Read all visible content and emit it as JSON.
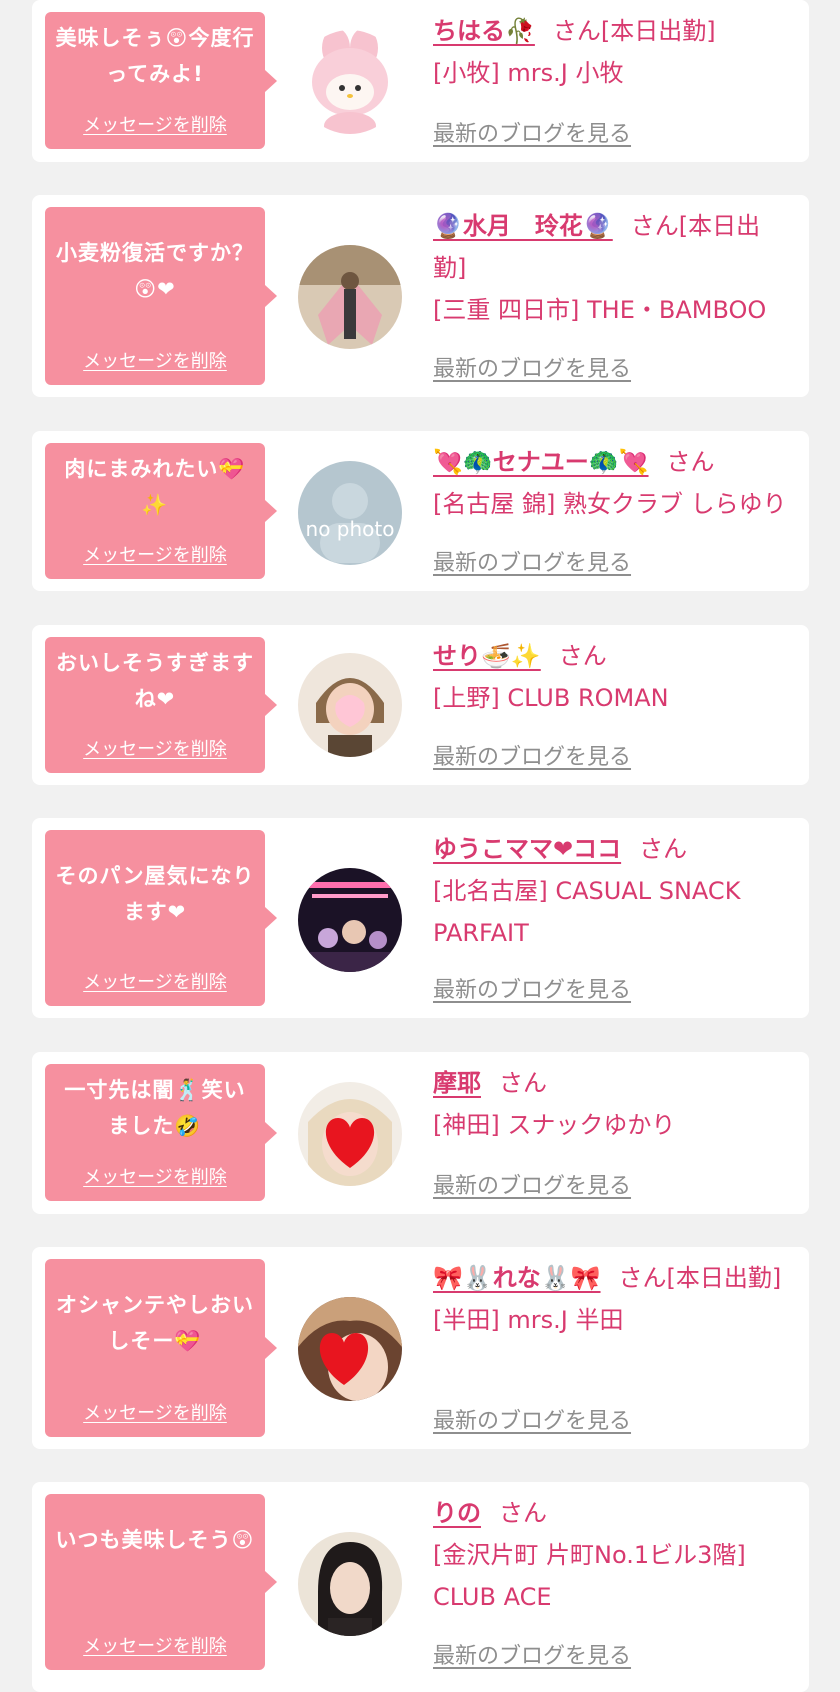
{
  "delete_label": "メッセージを削除",
  "blog_label": "最新のブログを見る",
  "colors": {
    "background": "#f1f1f1",
    "bubble": "#f6909f",
    "name": "#d83a6f",
    "link_gray": "#8e8e8e"
  },
  "cards": [
    {
      "message": "美味しそぅ😲今度行ってみよ!",
      "name": "ちはる🥀",
      "suffix": "さん[本日出勤]",
      "shop": "[小牧] mrs.J 小牧",
      "avatar_icon": "character-avatar-icon"
    },
    {
      "message": "小麦粉復活ですか？😲❤",
      "name": "🔮水月　玲花🔮",
      "suffix": "さん[本日出勤]",
      "shop": "[三重 四日市] THE・BAMBOO",
      "avatar_icon": "photo-avatar-icon"
    },
    {
      "message": "肉にまみれたい💝✨",
      "name": "💘🦚セナユー🦚💘",
      "suffix": "さん",
      "shop": "[名古屋 錦] 熟女クラブ しらゆり",
      "avatar_icon": "no-photo-avatar-icon",
      "avatar_text": "no photo"
    },
    {
      "message": "おいしそうすぎますね❤",
      "name": "せり🍜✨",
      "suffix": "さん",
      "shop": "[上野] CLUB ROMAN",
      "avatar_icon": "photo-avatar-icon"
    },
    {
      "message": "そのパン屋気になります❤",
      "name": "ゆうこママ❤ココ",
      "suffix": "さん",
      "shop": "[北名古屋] CASUAL SNACK PARFAIT",
      "avatar_icon": "photo-avatar-icon"
    },
    {
      "message": "一寸先は闇🕺笑いました🤣",
      "name": "摩耶",
      "suffix": "さん",
      "shop": "[神田] スナックゆかり",
      "avatar_icon": "heart-avatar-icon"
    },
    {
      "message": "オシャンテやしおいしそー💝",
      "name": "🎀🐰れな🐰🎀",
      "suffix": "さん[本日出勤]",
      "shop": "[半田] mrs.J 半田",
      "avatar_icon": "heart-avatar-icon"
    },
    {
      "message": "いつも美味しそう😲",
      "name": "りの",
      "suffix": "さん",
      "shop": "[金沢片町 片町No.1ビル3階] CLUB ACE",
      "avatar_icon": "photo-avatar-icon"
    }
  ]
}
